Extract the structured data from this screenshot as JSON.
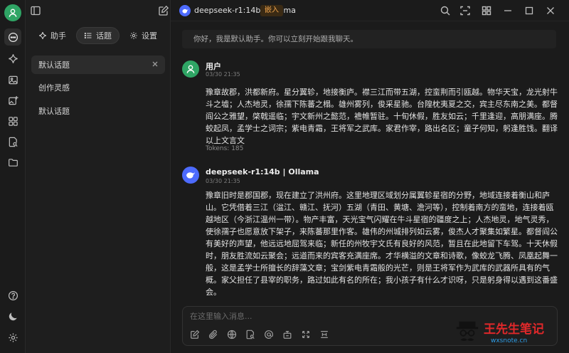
{
  "app": {
    "tabs": {
      "assistant": "助手",
      "topics": "话题",
      "settings": "设置"
    },
    "topics": [
      "默认话题",
      "创作灵感",
      "默认话题"
    ]
  },
  "header": {
    "model": "deepseek-r1:14b | Ollama",
    "tag": "嵌入"
  },
  "chat": {
    "greeting": "你好，我是默认助手。你可以立刻开始跟我聊天。",
    "user": {
      "name": "用户",
      "time": "03/30 21:35",
      "text": "豫章故郡，洪都新府。星分翼轸，地接衡庐。襟三江而带五湖，控蛮荆而引瓯越。物华天宝，龙光射牛斗之墟；人杰地灵，徐孺下陈蕃之榻。雄州雾列，俊采星驰。台隍枕夷夏之交，宾主尽东南之美。都督阎公之雅望，棨戟遥临；宇文新州之懿范，襜帷暂驻。十旬休假，胜友如云；千里逢迎，高朋满座。腾蛟起凤，孟学士之词宗；紫电青霜，王将军之武库。家君作宰，路出名区；童子何知，躬逢胜饯。翻译以上文言文",
      "tokens": "Tokens: 185"
    },
    "bot": {
      "name": "deepseek-r1:14b | Ollama",
      "time": "03/30 21:35",
      "text": "豫章旧时是郡国郡，现在建立了洪州府。这里地理区域划分属翼轸星宿的分野，地域连接着衡山和庐山。它凭借着三江（湓江、赣江、抚河）五湖（青田、黄塘、澹河等），控制着南方的蛮地，连接着瓯越地区（今浙江温州一带）。物产丰富，天光宝气闪耀在牛斗星宿的疆度之上；人杰地灵，地气灵秀，使徐孺子也愿意放下架子，来陈蕃那里作客。雄伟的州城排列如云雾，俊杰人才聚集如繁星。都督阎公有美好的声望，他远远地屈驾来临；新任的州牧宇文氏有良好的风范，暂且在此地留下车驾。十天休假时，朋友胜流如云聚会；远道而来的宾客充满座席。才华横溢的文章和诗歌，像蛟龙飞腾、凤凰起舞一般，这是孟学士所擅长的辞藻文章；宝剑紫电青霜般的光芒，则是王将军作为武库的武器所具有的气概。家父担任了县宰的职务，路过如此有名的所在；我小孩子有什么才识呀，只是躬身得以遇到这番盛会。"
    },
    "input_placeholder": "在这里输入消息..."
  },
  "watermark": {
    "text": "王先生笔记",
    "url": "wxsnote.cn"
  },
  "colors": {
    "accent": "#2fa565",
    "tag": "#f0a44c",
    "watermark": "#e0282a"
  }
}
